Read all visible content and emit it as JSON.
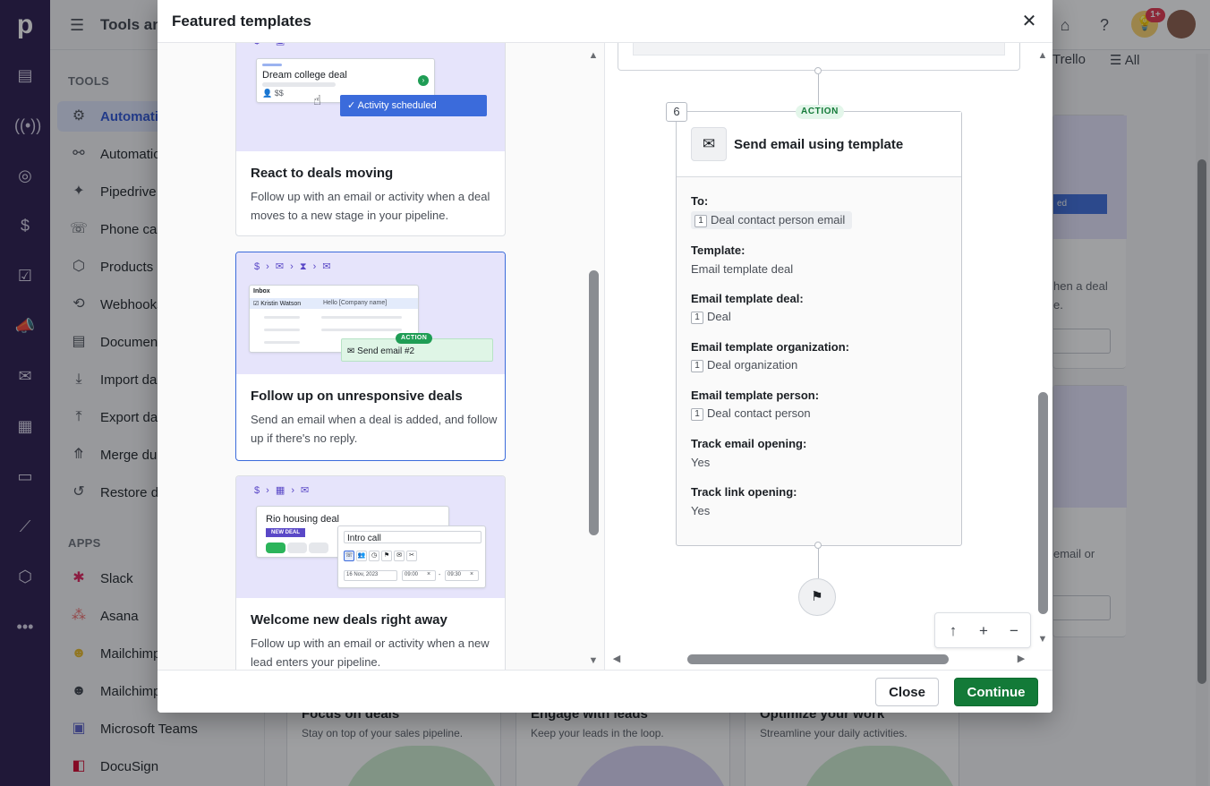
{
  "background": {
    "sidebar_title": "Tools an",
    "sections": {
      "tools": "TOOLS",
      "apps": "APPS"
    },
    "tools": [
      {
        "label": "Automatio",
        "icon": "automation-robot-icon",
        "glyph": "⚙",
        "active": true
      },
      {
        "label": "Automation",
        "icon": "automation-nodes-icon",
        "glyph": "⚯"
      },
      {
        "label": "Pipedrive",
        "icon": "sparkle-icon",
        "glyph": "✦"
      },
      {
        "label": "Phone cal",
        "icon": "phone-icon",
        "glyph": "☏"
      },
      {
        "label": "Products",
        "icon": "box-icon",
        "glyph": "⬡"
      },
      {
        "label": "Webhooks",
        "icon": "webhook-icon",
        "glyph": "⟲"
      },
      {
        "label": "Documen",
        "icon": "document-icon",
        "glyph": "▤"
      },
      {
        "label": "Import da",
        "icon": "import-icon",
        "glyph": "⤓"
      },
      {
        "label": "Export da",
        "icon": "export-icon",
        "glyph": "⤒"
      },
      {
        "label": "Merge du",
        "icon": "merge-icon",
        "glyph": "⤊"
      },
      {
        "label": "Restore d",
        "icon": "restore-icon",
        "glyph": "↺"
      }
    ],
    "apps": [
      {
        "label": "Slack",
        "icon": "slack-icon",
        "glyph": "✱",
        "color": "#e01e5a"
      },
      {
        "label": "Asana",
        "icon": "asana-icon",
        "glyph": "⁂",
        "color": "#f06a6a"
      },
      {
        "label": "Mailchimp",
        "icon": "mailchimp-icon",
        "glyph": "☻",
        "color": "#e8b923"
      },
      {
        "label": "Mailchimp",
        "icon": "mailchimp-icon",
        "glyph": "☻",
        "color": "#3a3f47"
      },
      {
        "label": "Microsoft Teams",
        "icon": "teams-icon",
        "glyph": "▣",
        "color": "#5b5fc7"
      },
      {
        "label": "DocuSign",
        "icon": "docusign-icon",
        "glyph": "◧",
        "color": "#d4002a"
      }
    ],
    "top_filters": {
      "trello": "Trello",
      "all": "All"
    },
    "notification_count": "1+",
    "bg_side_texts": [
      "hen a deal",
      "e.",
      "email or"
    ],
    "bg_button": "ed",
    "categories": [
      {
        "title": "Focus on deals",
        "subtitle": "Stay on top of your sales pipeline."
      },
      {
        "title": "Engage with leads",
        "subtitle": "Keep your leads in the loop."
      },
      {
        "title": "Optimize your work",
        "subtitle": "Streamline your daily activities."
      }
    ]
  },
  "modal": {
    "title": "Featured templates",
    "close_label": "Close",
    "continue_label": "Continue",
    "templates": [
      {
        "title": "React to deals moving",
        "description": "Follow up with an email or activity when a deal moves to a new stage in your pipeline.",
        "art": {
          "deal_name": "Dream college deal",
          "deal_value": "$$",
          "activity_label": "Activity scheduled"
        },
        "selected": false
      },
      {
        "title": "Follow up on unresponsive deals",
        "description": "Send an email when a deal is added, and follow up if there's no reply.",
        "art": {
          "inbox_label": "Inbox",
          "contact_name": "Kristin Watson",
          "greeting": "Hello [Company name]",
          "action_badge": "ACTION",
          "send_label": "Send email #2"
        },
        "selected": true
      },
      {
        "title": "Welcome new deals right away",
        "description": "Follow up with an email or activity when a new lead enters your pipeline.",
        "art": {
          "deal_name": "Rio housing deal",
          "new_badge": "NEW DEAL",
          "activity_subject": "Intro call",
          "date": "16 Nov, 2023",
          "time_from": "09:00",
          "time_separator": "-",
          "time_to": "09:30"
        },
        "selected": false
      }
    ],
    "flow": {
      "step_number": "6",
      "badge": "ACTION",
      "action_title": "Send email using template",
      "fields": [
        {
          "label": "To:",
          "chip_num": "1",
          "chip_text": "Deal contact person email",
          "style": "chip"
        },
        {
          "label": "Template:",
          "value": "Email template deal",
          "style": "plain"
        },
        {
          "label": "Email template deal:",
          "chip_num": "1",
          "chip_text": "Deal",
          "style": "num"
        },
        {
          "label": "Email template organization:",
          "chip_num": "1",
          "chip_text": "Deal organization",
          "style": "num"
        },
        {
          "label": "Email template person:",
          "chip_num": "1",
          "chip_text": "Deal contact person",
          "style": "num"
        },
        {
          "label": "Track email opening:",
          "value": "Yes",
          "style": "plain"
        },
        {
          "label": "Track link opening:",
          "value": "Yes",
          "style": "plain"
        }
      ]
    }
  }
}
